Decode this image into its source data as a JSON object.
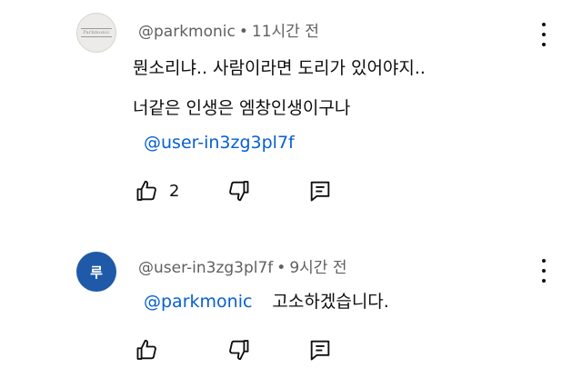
{
  "comments": [
    {
      "username": "@parkmonic",
      "time": "11시간 전",
      "avatar_text": "Parkmonic",
      "lines": [
        "뭔소리냐.. 사람이라면 도리가 있어야지..",
        "너같은 인생은 엠창인생이구나"
      ],
      "mention": "@user-in3zg3pl7f",
      "like_count": "2"
    },
    {
      "username": "@user-in3zg3pl7f",
      "time": "9시간 전",
      "avatar_text": "루",
      "avatar_color": "#1f5aa8",
      "mention": "@parkmonic",
      "text": "고소하겠습니다.",
      "like_count": ""
    }
  ],
  "separator": "•",
  "icons": {
    "like": "thumbs-up-icon",
    "dislike": "thumbs-down-icon",
    "reply": "reply-icon",
    "more": "more-vertical-icon"
  },
  "colors": {
    "mention": "#065fd4",
    "meta": "#606060",
    "text": "#0f0f0f"
  }
}
